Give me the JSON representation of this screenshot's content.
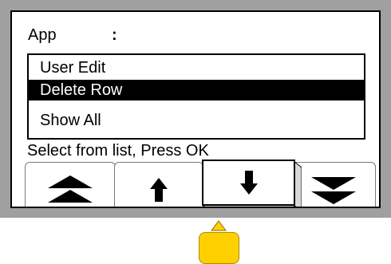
{
  "header": {
    "app_label": "App",
    "separator": ":"
  },
  "list": {
    "items": [
      {
        "label": "User Edit",
        "selected": false
      },
      {
        "label": "Delete Row",
        "selected": true
      },
      {
        "label": "Show All",
        "selected": false
      }
    ]
  },
  "status": {
    "text": "Select from list,  Press OK"
  },
  "softkeys": [
    {
      "icon": "double-up-icon",
      "pressed": false
    },
    {
      "icon": "arrow-up-icon",
      "pressed": false
    },
    {
      "icon": "arrow-down-icon",
      "pressed": true
    },
    {
      "icon": "double-down-icon",
      "pressed": false
    }
  ],
  "colors": {
    "bezel": "#a0a0a0",
    "screen": "#ffffff",
    "selection": "#000000",
    "ok_button": "#ffd000",
    "pointer": "#ffd000"
  }
}
